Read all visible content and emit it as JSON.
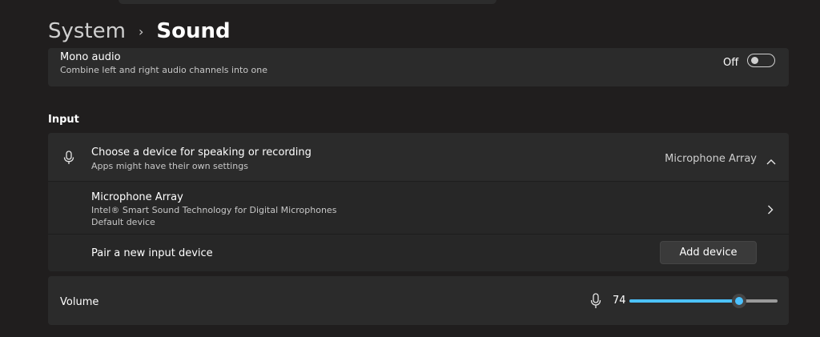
{
  "breadcrumb": {
    "parent": "System",
    "separator": "›",
    "current": "Sound"
  },
  "mono_audio": {
    "title": "Mono audio",
    "description": "Combine left and right audio channels into one",
    "state_label": "Off",
    "enabled": false
  },
  "input": {
    "section_label": "Input",
    "choose_device": {
      "title": "Choose a device for speaking or recording",
      "description": "Apps might have their own settings",
      "selected_device": "Microphone Array",
      "icon": "microphone-icon",
      "expand_icon": "chevron-up-icon"
    },
    "device": {
      "title": "Microphone Array",
      "description": "Intel® Smart Sound Technology for Digital Microphones",
      "status": "Default device",
      "icon": "chevron-right-icon"
    },
    "pair": {
      "title": "Pair a new input device",
      "button_label": "Add device"
    }
  },
  "volume": {
    "title": "Volume",
    "value": "74",
    "level": 0.74,
    "icon": "microphone-icon"
  },
  "colors": {
    "accent": "#4cc2ff",
    "background": "#201e1e",
    "card": "#2b2b2b"
  }
}
